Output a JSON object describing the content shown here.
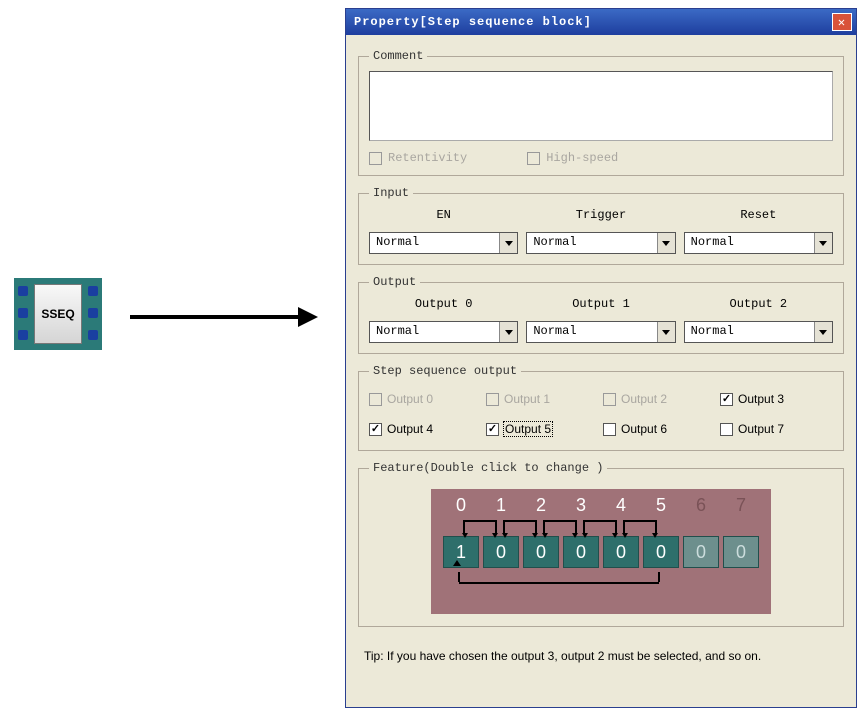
{
  "block_label": "SSEQ",
  "dialog": {
    "title": "Property[Step sequence block]",
    "comment_legend": "Comment",
    "comment_value": "",
    "retentivity_label": "Retentivity",
    "highspeed_label": "High-speed",
    "input_legend": "Input",
    "input": {
      "en_label": "EN",
      "en_value": "Normal",
      "trigger_label": "Trigger",
      "trigger_value": "Normal",
      "reset_label": "Reset",
      "reset_value": "Normal"
    },
    "output_legend": "Output",
    "output": {
      "o0_label": "Output 0",
      "o0_value": "Normal",
      "o1_label": "Output 1",
      "o1_value": "Normal",
      "o2_label": "Output 2",
      "o2_value": "Normal"
    },
    "stepseq_legend": "Step sequence output",
    "stepseq": {
      "o0": "Output 0",
      "o1": "Output 1",
      "o2": "Output 2",
      "o3": "Output 3",
      "o4": "Output 4",
      "o5": "Output 5",
      "o6": "Output 6",
      "o7": "Output 7"
    },
    "feature_legend": "Feature(Double click to change )",
    "feature": {
      "headers": [
        "0",
        "1",
        "2",
        "3",
        "4",
        "5",
        "6",
        "7"
      ],
      "values": [
        "1",
        "0",
        "0",
        "0",
        "0",
        "0",
        "0",
        "0"
      ],
      "active_count": 6
    },
    "tip": "Tip: If you have chosen the output 3, output 2 must be selected, and so on."
  }
}
